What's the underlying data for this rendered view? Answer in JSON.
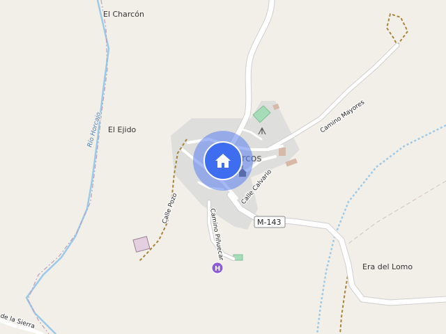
{
  "map": {
    "places": {
      "el_charcon": "El Charcón",
      "el_ejido": "El Ejido",
      "era_del_lomo": "Era del Lomo",
      "village_name": "Arcos"
    },
    "streets": {
      "camino_mayores": "Camino Mayores",
      "calle_calvario": "Calle Calvario",
      "calle_pozo": "Calle Pozo",
      "camino_pinuecar": "Camino Piñuecar",
      "bottom_road_fragment": "de la Sierra"
    },
    "waterways": {
      "rio_horcajo": "Río Horcajo"
    },
    "road_shields": {
      "m143": "M-143"
    },
    "markers": {
      "home_marker": "home-icon",
      "hospital_marker": "H"
    },
    "colors": {
      "background": "#f2efe9",
      "road": "#ffffff",
      "residential": "#d9d9d9",
      "river": "#9cc9e8",
      "track": "#a7843a",
      "home_circle": "#5b7ff0",
      "hospital": "#8c5cd6"
    }
  }
}
